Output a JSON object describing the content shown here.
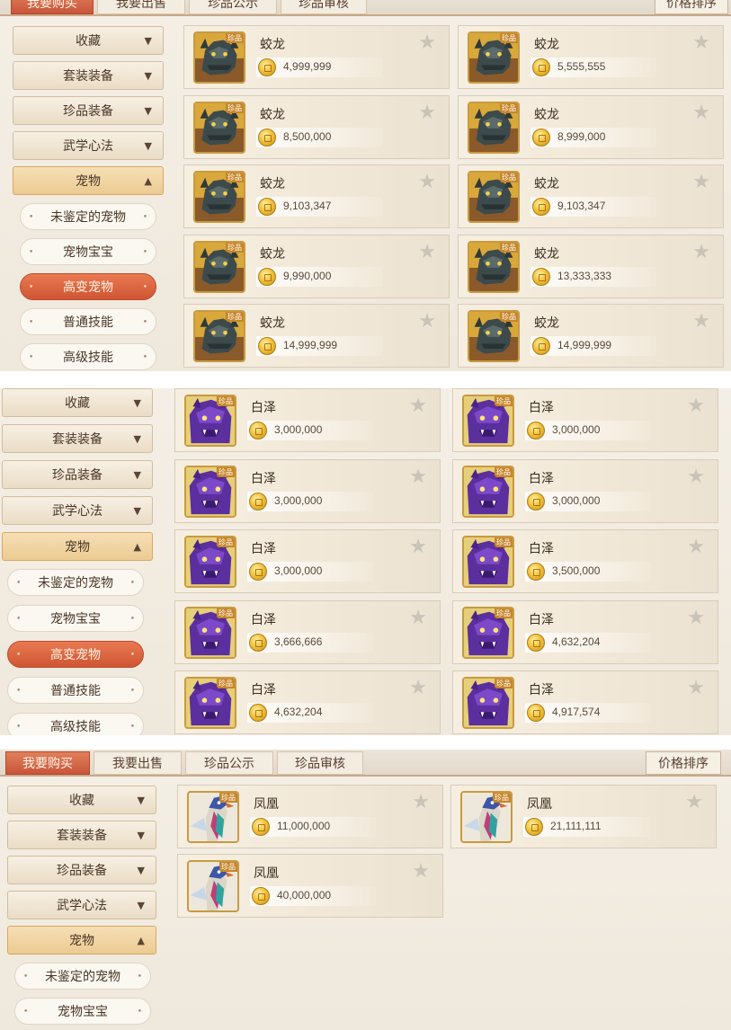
{
  "colors": {
    "accent": "#d4603d",
    "coin": "#f2c23e",
    "card_bg": "#f4ecde",
    "sidebar_open": "#eccb92"
  },
  "icons": {
    "favorite": "star-icon",
    "currency": "gold-coin-icon",
    "expand": "triangle-down-icon",
    "collapse": "triangle-up-icon"
  },
  "panels": [
    {
      "tabs": [
        "我要购买",
        "我要出售",
        "珍品公示",
        "珍品审核"
      ],
      "active_tab": 0,
      "sort_label": "价格排序",
      "sidebar": {
        "categories": [
          {
            "label": "收藏",
            "arrow": "▼"
          },
          {
            "label": "套装装备",
            "arrow": "▼"
          },
          {
            "label": "珍品装备",
            "arrow": "▼"
          },
          {
            "label": "武学心法",
            "arrow": "▼"
          },
          {
            "label": "宠物",
            "arrow": "▲"
          }
        ],
        "subitems": [
          "未鉴定的宠物",
          "宠物宝宝",
          "高变宠物",
          "普通技能",
          "高级技能"
        ],
        "active_sub": 2
      },
      "items": [
        {
          "name": "蛟龙",
          "price": "4,999,999",
          "tag": "珍品"
        },
        {
          "name": "蛟龙",
          "price": "5,555,555",
          "tag": "珍品"
        },
        {
          "name": "蛟龙",
          "price": "8,500,000",
          "tag": "珍品"
        },
        {
          "name": "蛟龙",
          "price": "8,999,000",
          "tag": "珍品"
        },
        {
          "name": "蛟龙",
          "price": "9,103,347",
          "tag": "珍品"
        },
        {
          "name": "蛟龙",
          "price": "9,103,347",
          "tag": "珍品"
        },
        {
          "name": "蛟龙",
          "price": "9,990,000",
          "tag": "珍品"
        },
        {
          "name": "蛟龙",
          "price": "13,333,333",
          "tag": "珍品"
        },
        {
          "name": "蛟龙",
          "price": "14,999,999",
          "tag": "珍品"
        },
        {
          "name": "蛟龙",
          "price": "14,999,999",
          "tag": "珍品"
        }
      ]
    },
    {
      "sidebar": {
        "categories": [
          {
            "label": "收藏",
            "arrow": "▼"
          },
          {
            "label": "套装装备",
            "arrow": "▼"
          },
          {
            "label": "珍品装备",
            "arrow": "▼"
          },
          {
            "label": "武学心法",
            "arrow": "▼"
          },
          {
            "label": "宠物",
            "arrow": "▲"
          }
        ],
        "subitems": [
          "未鉴定的宠物",
          "宠物宝宝",
          "高变宠物",
          "普通技能",
          "高级技能"
        ],
        "active_sub": 2
      },
      "items": [
        {
          "name": "白泽",
          "price": "3,000,000",
          "tag": "珍品"
        },
        {
          "name": "白泽",
          "price": "3,000,000",
          "tag": "珍品"
        },
        {
          "name": "白泽",
          "price": "3,000,000",
          "tag": "珍品"
        },
        {
          "name": "白泽",
          "price": "3,000,000",
          "tag": "珍品"
        },
        {
          "name": "白泽",
          "price": "3,000,000",
          "tag": "珍品"
        },
        {
          "name": "白泽",
          "price": "3,500,000",
          "tag": "珍品"
        },
        {
          "name": "白泽",
          "price": "3,666,666",
          "tag": "珍品"
        },
        {
          "name": "白泽",
          "price": "4,632,204",
          "tag": "珍品"
        },
        {
          "name": "白泽",
          "price": "4,632,204",
          "tag": "珍品"
        },
        {
          "name": "白泽",
          "price": "4,917,574",
          "tag": "珍品"
        }
      ]
    },
    {
      "tabs": [
        "我要购买",
        "我要出售",
        "珍品公示",
        "珍品审核"
      ],
      "active_tab": 0,
      "sort_label": "价格排序",
      "sidebar": {
        "categories": [
          {
            "label": "收藏",
            "arrow": "▼"
          },
          {
            "label": "套装装备",
            "arrow": "▼"
          },
          {
            "label": "珍品装备",
            "arrow": "▼"
          },
          {
            "label": "武学心法",
            "arrow": "▼"
          },
          {
            "label": "宠物",
            "arrow": "▲"
          }
        ],
        "subitems": [
          "未鉴定的宠物",
          "宠物宝宝"
        ],
        "active_sub": -1
      },
      "items": [
        {
          "name": "凤凰",
          "price": "11,000,000",
          "tag": "珍品"
        },
        {
          "name": "凤凰",
          "price": "21,111,111",
          "tag": "珍品"
        },
        {
          "name": "凤凰",
          "price": "40,000,000",
          "tag": "珍品"
        }
      ]
    }
  ]
}
